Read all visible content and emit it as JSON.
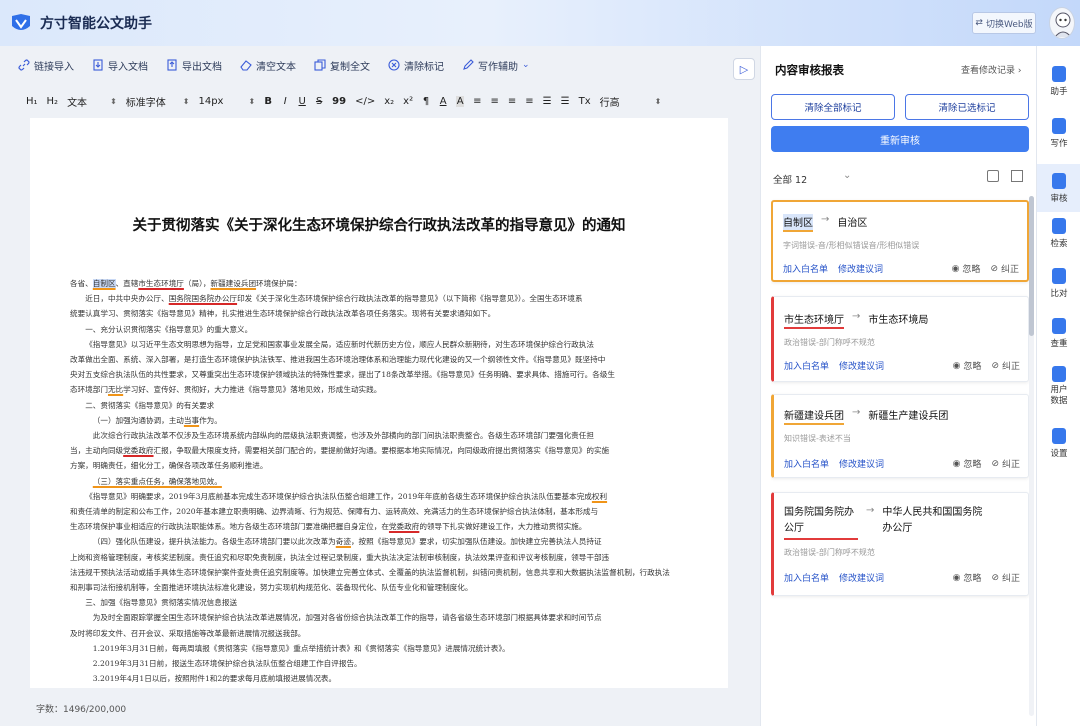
{
  "header": {
    "title": "方寸智能公文助手",
    "web_switch": "切换Web版"
  },
  "toolbar": {
    "items": [
      {
        "label": "链接导入",
        "icon": "link-icon"
      },
      {
        "label": "导入文档",
        "icon": "import-icon"
      },
      {
        "label": "导出文档",
        "icon": "export-icon"
      },
      {
        "label": "清空文本",
        "icon": "eraser-icon"
      },
      {
        "label": "复制全文",
        "icon": "copy-icon"
      },
      {
        "label": "清除标记",
        "icon": "clear-mark-icon"
      },
      {
        "label": "写作辅助",
        "icon": "pen-icon"
      }
    ],
    "collapse": "▷"
  },
  "format_bar": {
    "h1": "H₁",
    "h2": "H₂",
    "para": "文本",
    "font": "标准字体",
    "size": "14px",
    "line_height": "行高",
    "buttons": [
      "B",
      "I",
      "U",
      "S",
      "99",
      "</>",
      "x₂",
      "x²",
      "¶",
      "A",
      "A",
      "≡",
      "≡",
      "≡",
      "≡",
      "☰",
      "☰",
      "Tx"
    ]
  },
  "document": {
    "title": "关于贯彻落实《关于深化生态环境保护综合行政执法改革的指导意见》的通知",
    "salutation": {
      "pre": "各省、",
      "a": "自制区",
      "b": "、直辖",
      "c": "市生态环境厅",
      "d": "（局），",
      "e": "新疆建设兵团",
      "f": "环境保护局："
    },
    "line2": {
      "pre": "近日，中共中央办公厅、",
      "u": "国务院国务院办公厅",
      "post": "印发《关于深化生态环境保护综合行政执法改革的指导意见》（以下简称《指导意见》）。全国生态环境系"
    },
    "lines": [
      "统要认真学习、贯彻落实《指导意见》精神，扎实推进生态环境保护综合行政执法改革各项任务落实。现将有关要求通知如下。",
      "一、充分认识贯彻落实《指导意见》的重大意义。",
      "《指导意见》以习近平生态文明思想为指导，立足党和国家事业发展全局，适应新时代新历史方位，顺应人民群众新期待，对生态环境保护综合行政执法",
      "改革做出全面、系统、深入部署，是打造生态环境保护执法铁军、推进我国生态环境治理体系和治理能力现代化建设的又一个纲领性文件。《指导意见》既坚持中",
      "央对五支综合执法队伍的共性要求，又尊重突出生态环境保护领域执法的特殊性要求，提出了18条改革举措。《指导意见》任务明确、要求具体、措施可行。各级生"
    ],
    "line_wuzhi": {
      "pre": "态环境部门",
      "u": "无比",
      "post": "学习好、宣传好、贯彻好，大力推进《指导意见》落地见效，形成生动实践。"
    },
    "line_sec2": "二、贯彻落实《指导意见》的有关要求",
    "line_sub1": {
      "pre": "（一）加强沟通协调，主动",
      "u": "当事",
      "post": "作为。"
    },
    "line_p1": "此次综合行政执法改革不仅涉及生态环境系统内部纵向的层级执法职责调整，也涉及外部横向的部门间执法职责整合。各级生态环境部门要强化责任担",
    "line_p2": {
      "pre": "当，主动向同级",
      "u": "党委政府",
      "post": "汇报，争取最大限度支持，需要相关部门配合的，要提前做好沟通。要根据本地实际情况，向同级政府提出贯彻落实《指导意见》的实施"
    },
    "line_p3": "方案，明确责任，细化分工，确保各项改革任务顺利推进。",
    "line_sub3": "（三）落实重点任务，确保落地见效。",
    "line_p4": {
      "pre": "《指导意见》明确要求，2019年3月底前基本完成生态环境保护综合执法队伍整合组建工作，2019年年底前各级生态环境保护综合执法队伍要基本完成",
      "u": "权利"
    },
    "line_p5": "和责任清单的制定和公布工作，2020年基本建立职责明确、边界清晰、行为规范、保障有力、运转高效、充满活力的生态环境保护综合执法体制，基本形成与",
    "line_p6": {
      "pre": "生态环境保护事业相适应的行政执法职能体系。地方各级生态环境部门要准确把握自身定位，在",
      "u": "党委政府",
      "post": "的领导下扎实做好建设工作，大力推动贯彻实施。"
    },
    "line_p7": {
      "pre": "（四）强化队伍建设，提升执法能力。各级生态环境部门要以此次改革为",
      "u": "奇迹",
      "post": "，按照《指导意见》要求，切实加强队伍建设。加快建立完善执法人员持证"
    },
    "lines_after": [
      "上岗和资格管理制度，考核奖惩制度。责任追究和尽职免责制度，执法全过程记录制度，重大执法决定法制审核制度，执法效果评查和评议考核制度，领导干部违",
      "法违规干预执法活动或插手具体生态环境保护案件查处责任追究制度等。加快建立完善立体式、全覆盖的执法监督机制，纠错问责机制，信息共享和大数据执法监督机制，行政执法",
      "和刑事司法衔接机制等，全面推进环境执法标准化建设，努力实现机构规范化、装备现代化、队伍专业化和管理制度化。",
      "三、加强《指导意见》贯彻落实情况信息报送",
      "为及时全面跟踪掌握全国生态环境保护综合执法改革进展情况，加强对各省份综合执法改革工作的指导，请各省级生态环境部门根据具体要求和时间节点",
      "及时将印发文件、召开会议、采取措施等改革最新进展情况报送我部。",
      "1.2019年3月31日前，每两周填报《贯彻落实《指导意见》重点举措统计表》和《贯彻落实《指导意见》进展情况统计表》。",
      "2.2019年3月31日前，报送生态环境保护综合执法队伍整合组建工作自评报告。",
      "3.2019年4月1日以后，按照附件1和2的要求每月底前填报进展情况表。"
    ],
    "word_count": "字数：1496/200,000"
  },
  "panel": {
    "title": "内容审核报表",
    "view_log": "查看修改记录 ›",
    "btn_clear_all": "清除全部标记",
    "btn_clear_done": "清除已选标记",
    "btn_recheck": "重新审核",
    "filter_label": "全部 12",
    "cards": [
      {
        "from": "自制区",
        "to": "自治区",
        "note": "字词错误-音/形相似错误音/形相似错误",
        "add": "加入白名单",
        "suggest": "修改建议词",
        "ignore": "忽略",
        "fix": "纠正"
      },
      {
        "from": "市生态环境厅",
        "to": "市生态环境局",
        "note": "政治错误-部门称呼不规范",
        "add": "加入白名单",
        "suggest": "修改建议词",
        "ignore": "忽略",
        "fix": "纠正"
      },
      {
        "from": "新疆建设兵团",
        "to": "新疆生产建设兵团",
        "note": "知识错误-表述不当",
        "add": "加入白名单",
        "suggest": "修改建议词",
        "ignore": "忽略",
        "fix": "纠正"
      },
      {
        "from": "国务院国务院办公厅",
        "to": "中华人民共和国国务院办公厅",
        "note": "政治错误-部门称呼不规范",
        "add": "加入白名单",
        "suggest": "修改建议词",
        "ignore": "忽略",
        "fix": "纠正"
      }
    ]
  },
  "sidebar": {
    "items": [
      {
        "label": "助手",
        "icon": "assistant-icon"
      },
      {
        "label": "写作",
        "icon": "write-icon"
      },
      {
        "label": "审核",
        "icon": "review-icon",
        "active": true
      },
      {
        "label": "检索",
        "icon": "search-icon"
      },
      {
        "label": "比对",
        "icon": "compare-icon"
      },
      {
        "label": "查重",
        "icon": "duplicate-icon"
      },
      {
        "label": "用户数据",
        "icon": "user-data-icon"
      },
      {
        "label": "设置",
        "icon": "settings-icon"
      }
    ]
  },
  "colors": {
    "accent": "#3f7df0",
    "error_red": "#d62828",
    "warn_orange": "#f09418"
  }
}
